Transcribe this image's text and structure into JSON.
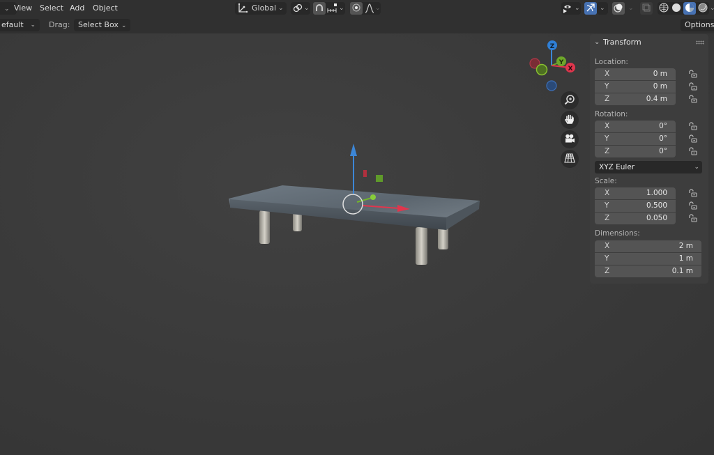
{
  "header": {
    "menu": [
      {
        "label": "View"
      },
      {
        "label": "Select"
      },
      {
        "label": "Add"
      },
      {
        "label": "Object"
      }
    ],
    "transform_orientation": {
      "label": "Global",
      "icon": "orientation-axes-icon"
    },
    "pivot": {
      "icon": "link-pivot-icon"
    },
    "snap": {
      "icon": "magnet-snap-icon",
      "increment_icon": "snap-increment-icon"
    },
    "proportional_edit": {
      "icon": "proportional-edit-icon",
      "falloff_icon": "falloff-curve-icon"
    },
    "visibility": {
      "icon": "eye-visibility-icon"
    },
    "gizmo_toggle": {
      "icon": "gizmo-toggle-icon",
      "active": true
    },
    "overlays": {
      "icon": "overlays-icon"
    },
    "xray": {
      "icon": "xray-icon"
    },
    "shading_modes": [
      {
        "name": "wireframe",
        "icon": "wireframe-shading-icon",
        "active": false
      },
      {
        "name": "solid",
        "icon": "solid-shading-icon",
        "active": false
      },
      {
        "name": "material-preview",
        "icon": "material-preview-icon",
        "active": true
      },
      {
        "name": "rendered",
        "icon": "rendered-shading-icon",
        "active": false
      }
    ]
  },
  "toolbar2": {
    "orientation_value": "efault",
    "drag_label": "Drag:",
    "drag_value": "Select Box",
    "options_label": "Options"
  },
  "gizmo": {
    "axes": [
      {
        "label": "Z",
        "color": "#2f7fd6"
      },
      {
        "label": "Y",
        "color": "#6ea72a"
      },
      {
        "label": "X",
        "color": "#e0364d"
      }
    ]
  },
  "nav_buttons": [
    {
      "name": "zoom",
      "icon": "zoom-icon"
    },
    {
      "name": "pan",
      "icon": "hand-pan-icon"
    },
    {
      "name": "camera",
      "icon": "camera-view-icon"
    },
    {
      "name": "ortho",
      "icon": "perspective-grid-icon"
    }
  ],
  "transform_panel": {
    "title": "Transform",
    "location": {
      "label": "Location:",
      "rows": [
        {
          "axis": "X",
          "value": "0 m"
        },
        {
          "axis": "Y",
          "value": "0 m"
        },
        {
          "axis": "Z",
          "value": "0.4 m"
        }
      ]
    },
    "rotation": {
      "label": "Rotation:",
      "rows": [
        {
          "axis": "X",
          "value": "0°"
        },
        {
          "axis": "Y",
          "value": "0°"
        },
        {
          "axis": "Z",
          "value": "0°"
        }
      ],
      "mode": "XYZ Euler"
    },
    "scale": {
      "label": "Scale:",
      "rows": [
        {
          "axis": "X",
          "value": "1.000"
        },
        {
          "axis": "Y",
          "value": "0.500"
        },
        {
          "axis": "Z",
          "value": "0.050"
        }
      ]
    },
    "dimensions": {
      "label": "Dimensions:",
      "rows": [
        {
          "axis": "X",
          "value": "2 m"
        },
        {
          "axis": "Y",
          "value": "1 m"
        },
        {
          "axis": "Z",
          "value": "0.1 m"
        }
      ]
    }
  },
  "colors": {
    "accent": "#4772b3",
    "axis_x": "#e0364d",
    "axis_y": "#6ea72a",
    "axis_z": "#2f7fd6"
  }
}
